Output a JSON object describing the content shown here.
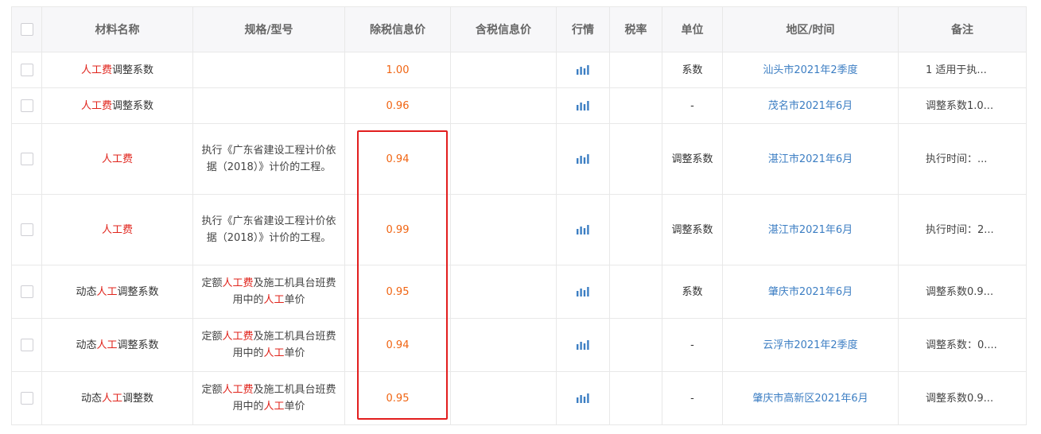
{
  "headers": {
    "name": "材料名称",
    "spec": "规格/型号",
    "price_ex_tax": "除税信息价",
    "price_inc_tax": "含税信息价",
    "trend": "行情",
    "tax_rate": "税率",
    "unit": "单位",
    "region_time": "地区/时间",
    "remark": "备注"
  },
  "rows": [
    {
      "name_parts": [
        {
          "t": "人工费",
          "hl": true
        },
        {
          "t": "调整系数",
          "hl": false
        }
      ],
      "spec_parts": [],
      "price_ex_tax": "1.00",
      "price_inc_tax": "",
      "tax_rate": "",
      "unit": "系数",
      "region_time": "汕头市2021年2季度",
      "remark": "1 适用于执..."
    },
    {
      "name_parts": [
        {
          "t": "人工费",
          "hl": true
        },
        {
          "t": "调整系数",
          "hl": false
        }
      ],
      "spec_parts": [],
      "price_ex_tax": "0.96",
      "price_inc_tax": "",
      "tax_rate": "",
      "unit": "-",
      "region_time": "茂名市2021年6月",
      "remark": "调整系数1.0..."
    },
    {
      "name_parts": [
        {
          "t": "人工费",
          "hl": true
        }
      ],
      "spec_parts": [
        {
          "t": "执行《广东省建设工程计价依据（2018）》计价的工程。",
          "hl": false
        }
      ],
      "price_ex_tax": "0.94",
      "price_inc_tax": "",
      "tax_rate": "",
      "unit": "调整系数",
      "region_time": "湛江市2021年6月",
      "remark": "执行时间：..."
    },
    {
      "name_parts": [
        {
          "t": "人工费",
          "hl": true
        }
      ],
      "spec_parts": [
        {
          "t": "执行《广东省建设工程计价依据（2018）》计价的工程。",
          "hl": false
        }
      ],
      "price_ex_tax": "0.99",
      "price_inc_tax": "",
      "tax_rate": "",
      "unit": "调整系数",
      "region_time": "湛江市2021年6月",
      "remark": "执行时间：2..."
    },
    {
      "name_parts": [
        {
          "t": "动态",
          "hl": false
        },
        {
          "t": "人工",
          "hl": true
        },
        {
          "t": "调整系数",
          "hl": false
        }
      ],
      "spec_parts": [
        {
          "t": "定额",
          "hl": false
        },
        {
          "t": "人工费",
          "hl": true
        },
        {
          "t": "及施工机具台班费用中的",
          "hl": false
        },
        {
          "t": "人工",
          "hl": true
        },
        {
          "t": "单价",
          "hl": false
        }
      ],
      "price_ex_tax": "0.95",
      "price_inc_tax": "",
      "tax_rate": "",
      "unit": "系数",
      "region_time": "肇庆市2021年6月",
      "remark": "调整系数0.9..."
    },
    {
      "name_parts": [
        {
          "t": "动态",
          "hl": false
        },
        {
          "t": "人工",
          "hl": true
        },
        {
          "t": "调整系数",
          "hl": false
        }
      ],
      "spec_parts": [
        {
          "t": "定额",
          "hl": false
        },
        {
          "t": "人工费",
          "hl": true
        },
        {
          "t": "及施工机具台班费用中的",
          "hl": false
        },
        {
          "t": "人工",
          "hl": true
        },
        {
          "t": "单价",
          "hl": false
        }
      ],
      "price_ex_tax": "0.94",
      "price_inc_tax": "",
      "tax_rate": "",
      "unit": "-",
      "region_time": "云浮市2021年2季度",
      "remark": "调整系数：0...."
    },
    {
      "name_parts": [
        {
          "t": "动态",
          "hl": false
        },
        {
          "t": "人工",
          "hl": true
        },
        {
          "t": "调整数",
          "hl": false
        }
      ],
      "spec_parts": [
        {
          "t": "定额",
          "hl": false
        },
        {
          "t": "人工费",
          "hl": true
        },
        {
          "t": "及施工机具台班费用中的",
          "hl": false
        },
        {
          "t": "人工",
          "hl": true
        },
        {
          "t": "单价",
          "hl": false
        }
      ],
      "price_ex_tax": "0.95",
      "price_inc_tax": "",
      "tax_rate": "",
      "unit": "-",
      "region_time": "肇庆市高新区2021年6月",
      "remark": "调整系数0.9..."
    }
  ],
  "icons": {
    "row_checkbox": "checkbox-icon",
    "trend": "bar-chart-icon"
  },
  "colors": {
    "keyword_highlight": "#e0241c",
    "price": "#f06412",
    "link": "#3c7ec3",
    "annotation_box": "#e21e1e",
    "trend_icon": "#3c7ec3"
  }
}
